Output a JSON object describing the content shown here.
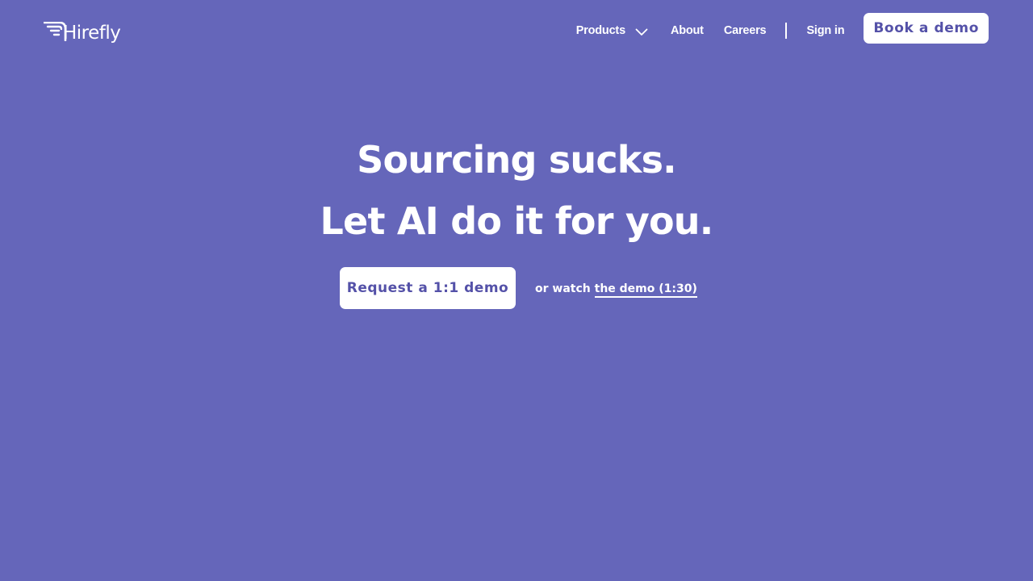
{
  "colors": {
    "background": "#6566BA",
    "button_text": "#5451A8",
    "button_bg": "#ffffff",
    "text": "#ffffff"
  },
  "header": {
    "logo_text": "Hirefly",
    "logo_icon": "winged-logo-icon",
    "nav": {
      "products_label": "Products",
      "products_icon": "chevron-down-icon",
      "about_label": "About",
      "careers_label": "Careers",
      "signin_label": "Sign in"
    },
    "book_demo_label": "Book a demo"
  },
  "hero": {
    "headline_line1": "Sourcing sucks.",
    "headline_line2": "Let AI do it for you.",
    "request_demo_label": "Request a 1:1 demo",
    "watch_prefix": "or watch",
    "watch_link_label": "the demo (1:30)"
  }
}
